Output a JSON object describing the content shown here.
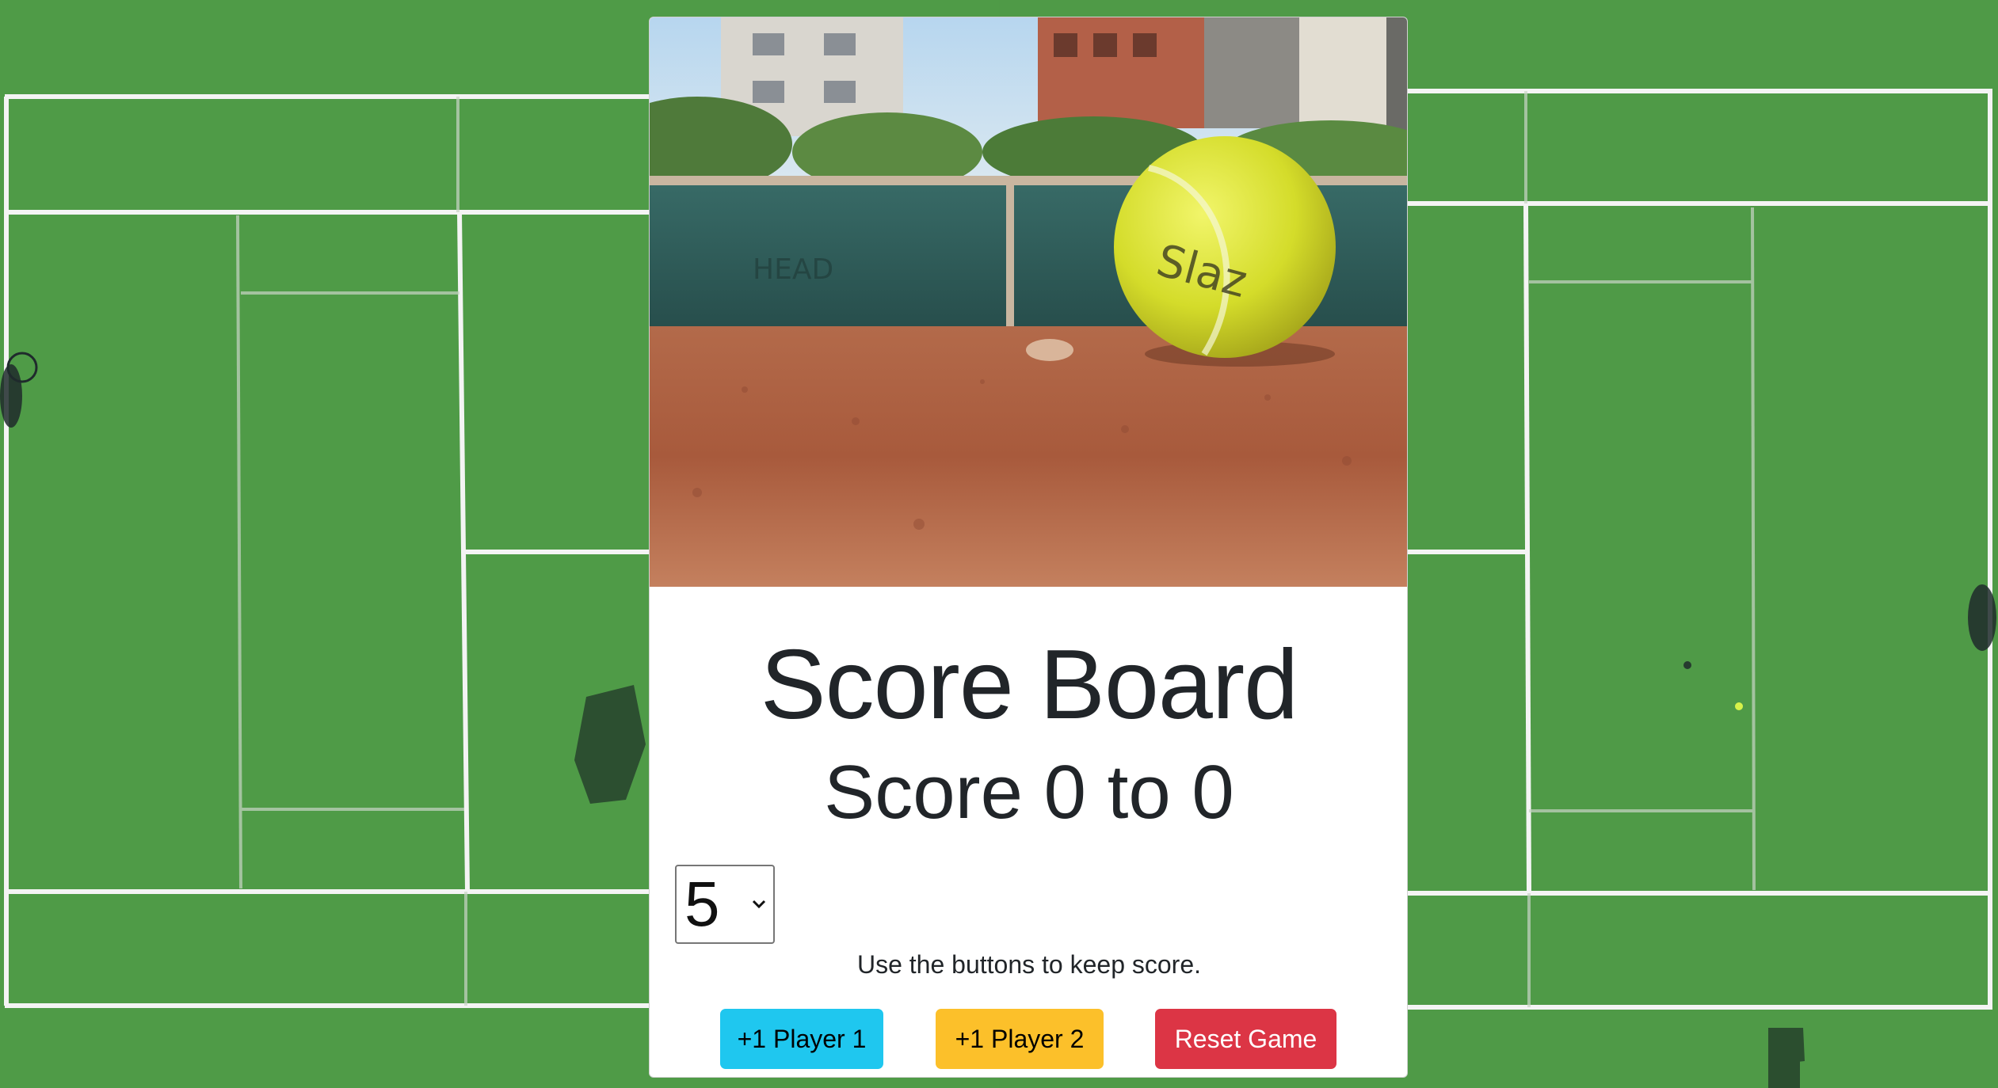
{
  "card": {
    "title": "Score Board",
    "score_text": "Score 0 to 0",
    "select": {
      "selected_value": "5"
    },
    "instructions": "Use the buttons to keep score.",
    "buttons": {
      "player1_label": "+1 Player 1",
      "player2_label": "+1 Player 2",
      "reset_label": "Reset Game"
    },
    "image_alt_icon": "tennis-ball-image"
  },
  "colors": {
    "court_green": "#4f9a47",
    "court_lines": "#ffffff",
    "player1_button": "#1fc7ef",
    "player2_button": "#fcc02a",
    "reset_button": "#dc3545",
    "text": "#212529"
  }
}
